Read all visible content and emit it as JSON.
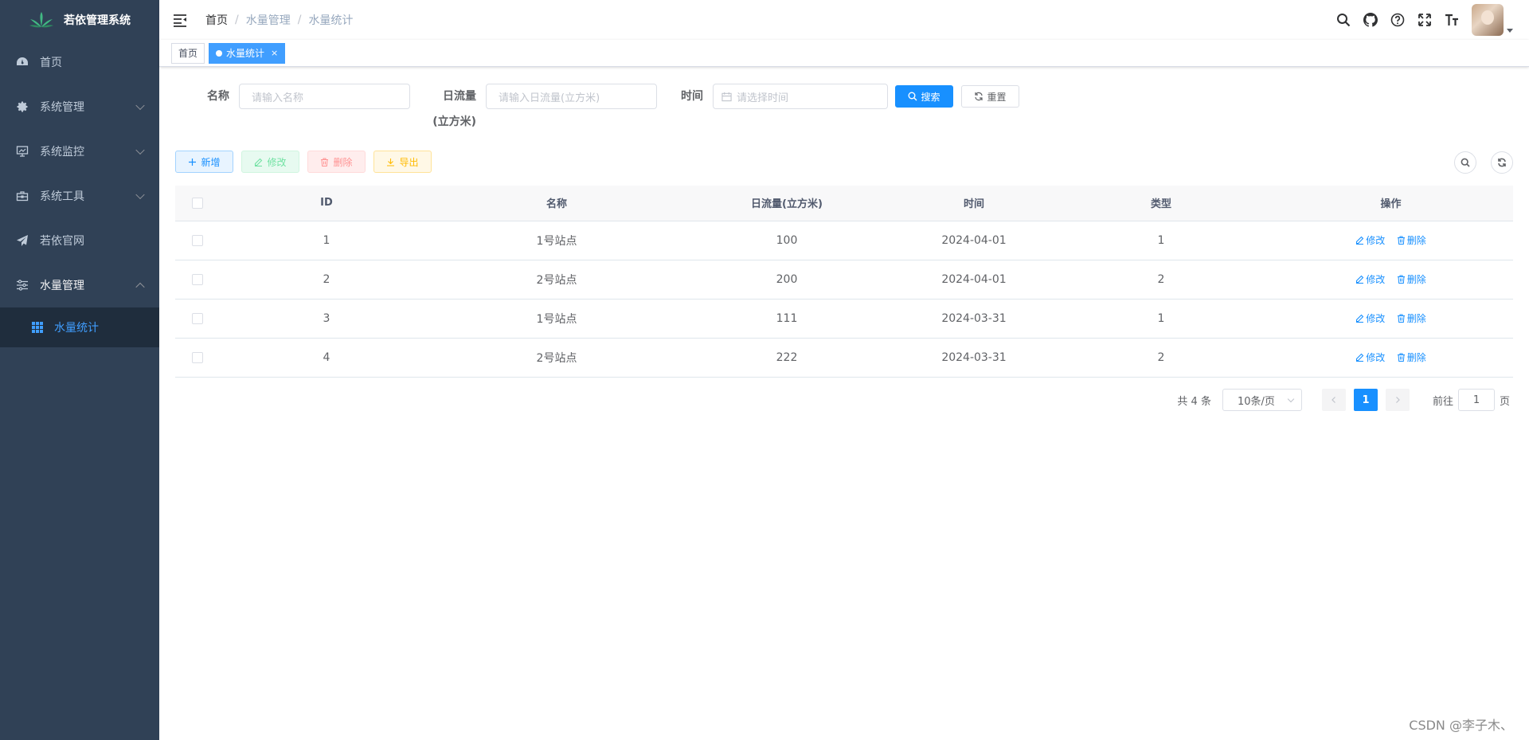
{
  "sidebar": {
    "logo_title": "若依管理系统",
    "items": [
      {
        "label": "首页",
        "icon": "dashboard-icon"
      },
      {
        "label": "系统管理",
        "icon": "gear-icon"
      },
      {
        "label": "系统监控",
        "icon": "monitor-icon"
      },
      {
        "label": "系统工具",
        "icon": "toolbox-icon"
      },
      {
        "label": "若依官网",
        "icon": "paper-plane-icon"
      },
      {
        "label": "水量管理",
        "icon": "sliders-icon"
      }
    ],
    "sub_item": {
      "label": "水量统计",
      "icon": "table-grid-icon"
    }
  },
  "navbar": {
    "breadcrumb": [
      "首页",
      "水量管理",
      "水量统计"
    ],
    "separator": "/"
  },
  "tags": {
    "home": "首页",
    "active": "水量统计",
    "close": "×"
  },
  "search": {
    "name_label": "名称",
    "name_placeholder": "请输入名称",
    "flow_label_line1": "日流量",
    "flow_label_line2": "(立方米)",
    "flow_placeholder": "请输入日流量(立方米)",
    "time_label": "时间",
    "time_placeholder": "请选择时间",
    "search_btn": "搜索",
    "reset_btn": "重置"
  },
  "toolbar": {
    "add": "新增",
    "edit": "修改",
    "delete": "删除",
    "export": "导出"
  },
  "table": {
    "headers": [
      "ID",
      "名称",
      "日流量(立方米)",
      "时间",
      "类型",
      "操作"
    ],
    "rows": [
      {
        "id": "1",
        "name": "1号站点",
        "flow": "100",
        "time": "2024-04-01",
        "type": "1"
      },
      {
        "id": "2",
        "name": "2号站点",
        "flow": "200",
        "time": "2024-04-01",
        "type": "2"
      },
      {
        "id": "3",
        "name": "1号站点",
        "flow": "111",
        "time": "2024-03-31",
        "type": "1"
      },
      {
        "id": "4",
        "name": "2号站点",
        "flow": "222",
        "time": "2024-03-31",
        "type": "2"
      }
    ],
    "op_edit": "修改",
    "op_delete": "删除"
  },
  "pagination": {
    "total": "共 4 条",
    "page_size": "10条/页",
    "current": "1",
    "goto_prefix": "前往",
    "goto_value": "1",
    "goto_suffix": "页"
  },
  "watermark": "CSDN @李子木、"
}
